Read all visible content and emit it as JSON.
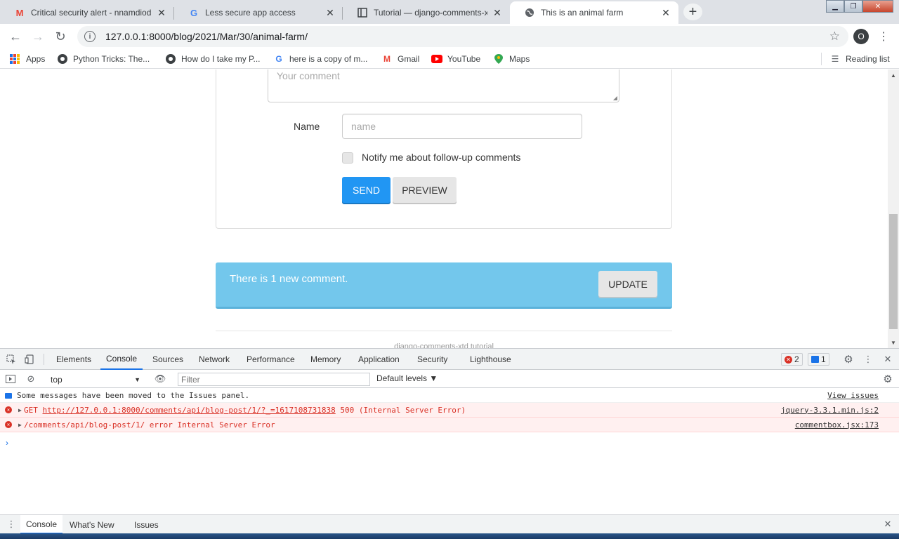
{
  "tabs": [
    {
      "title": "Critical security alert - nnamdiod",
      "icon": "gmail-icon"
    },
    {
      "title": "Less secure app access",
      "icon": "google-icon"
    },
    {
      "title": "Tutorial — django-comments-xtd",
      "icon": "doc-icon"
    },
    {
      "title": "This is an animal farm",
      "icon": "globe-icon",
      "active": true
    }
  ],
  "toolbar": {
    "url": "127.0.0.1:8000/blog/2021/Mar/30/animal-farm/",
    "profile_initial": "O"
  },
  "bookmarks": {
    "apps": "Apps",
    "items": [
      {
        "label": "Python Tricks: The..."
      },
      {
        "label": "How do I take my P..."
      },
      {
        "label": "here is a copy of m..."
      },
      {
        "label": "Gmail"
      },
      {
        "label": "YouTube"
      },
      {
        "label": "Maps"
      }
    ],
    "reading_list": "Reading list"
  },
  "form": {
    "comment_placeholder": "Your comment",
    "name_label": "Name",
    "name_placeholder": "name",
    "notify_label": "Notify me about follow-up comments",
    "send_label": "SEND",
    "preview_label": "PREVIEW"
  },
  "alert": {
    "text": "There is 1 new comment.",
    "update_label": "UPDATE"
  },
  "footer": {
    "text": "django-comments-xtd tutorial"
  },
  "devtools": {
    "tabs": [
      "Elements",
      "Console",
      "Sources",
      "Network",
      "Performance",
      "Memory",
      "Application",
      "Security",
      "Lighthouse"
    ],
    "active_tab": "Console",
    "error_count": "2",
    "message_count": "1",
    "context": "top",
    "filter_placeholder": "Filter",
    "levels": "Default levels ▼",
    "messages": [
      {
        "type": "info",
        "text": "Some messages have been moved to the Issues panel.",
        "source": "View issues"
      },
      {
        "type": "error",
        "method": "GET",
        "url": "http://127.0.0.1:8000/comments/api/blog-post/1/?_=1617108731838",
        "status": "500 (Internal Server Error)",
        "source": "jquery-3.3.1.min.js:2"
      },
      {
        "type": "error",
        "text": "/comments/api/blog-post/1/ error Internal Server Error",
        "source": "commentbox.jsx:173"
      }
    ],
    "drawer_tabs": [
      "Console",
      "What's New",
      "Issues"
    ]
  },
  "colors": {
    "send_button": "#2196f3",
    "alert_bg": "#73c7ec",
    "error_text": "#d93025",
    "devtools_active": "#1a73e8"
  }
}
